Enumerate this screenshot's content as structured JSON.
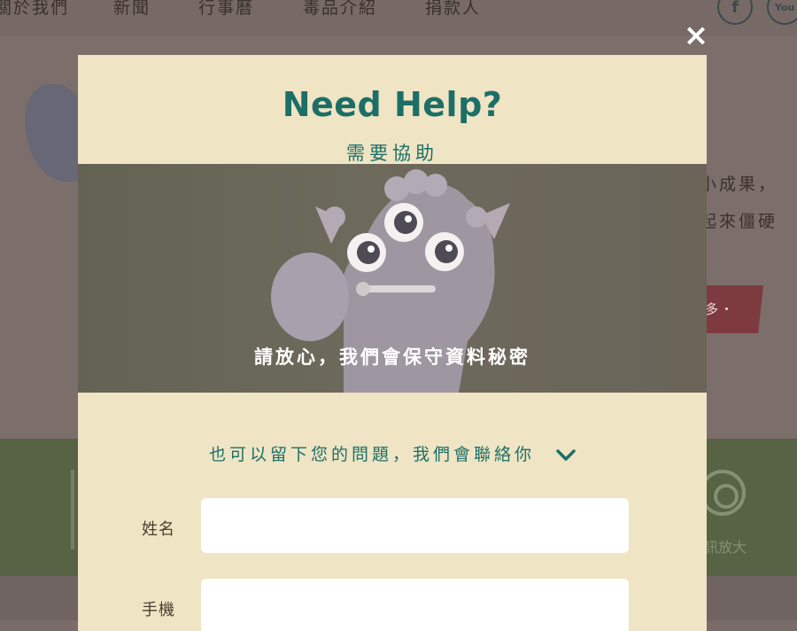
{
  "background": {
    "nav": [
      "關於我們",
      "新聞",
      "行事曆",
      "毒品介紹",
      "捐款人"
    ],
    "social": [
      "facebook-icon",
      "youtube-icon"
    ],
    "text_lines": [
      "小成果，",
      "起來僵硬"
    ],
    "more_button": "多・",
    "band_text": "訊放大"
  },
  "modal": {
    "close": "×",
    "title": "Need Help?",
    "subtitle": "需要協助",
    "banner_text": "請放心，我們會保守資料秘密",
    "prompt": "也可以留下您的問題，我們會聯絡你",
    "fields": [
      {
        "label": "姓名",
        "value": "",
        "placeholder": ""
      },
      {
        "label": "手機",
        "value": "",
        "placeholder": ""
      }
    ]
  },
  "colors": {
    "accent": "#1c6f67",
    "modal_bg": "#efe4c4",
    "overlay": "#7a6d69"
  }
}
